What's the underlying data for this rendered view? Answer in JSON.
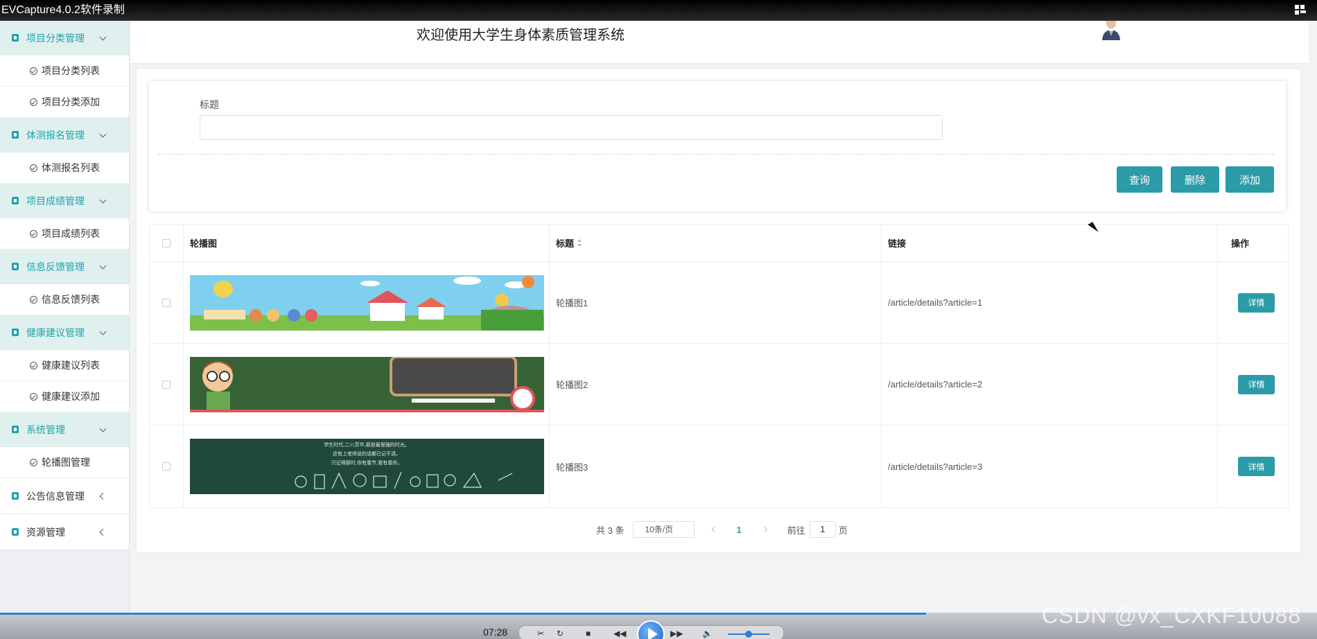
{
  "recorder": {
    "title": "EVCapture4.0.2软件录制",
    "time": "07:28",
    "watermark": "CSDN @vx_CXKF10088"
  },
  "header": {
    "title": "欢迎使用大学生身体素质管理系统"
  },
  "sidebar": {
    "groups": [
      {
        "label": "项目分类管理",
        "items": [
          "项目分类列表",
          "项目分类添加"
        ]
      },
      {
        "label": "体测报名管理",
        "items": [
          "体测报名列表"
        ]
      },
      {
        "label": "项目成绩管理",
        "items": [
          "项目成绩列表"
        ]
      },
      {
        "label": "信息反馈管理",
        "items": [
          "信息反馈列表"
        ]
      },
      {
        "label": "健康建议管理",
        "items": [
          "健康建议列表",
          "健康建议添加"
        ]
      },
      {
        "label": "系统管理",
        "items": [
          "轮播图管理"
        ]
      },
      {
        "label": "公告信息管理",
        "items": []
      },
      {
        "label": "资源管理",
        "items": []
      }
    ]
  },
  "search": {
    "label": "标题",
    "value": "",
    "buttons": {
      "query": "查询",
      "delete": "删除",
      "add": "添加"
    }
  },
  "table": {
    "headers": {
      "image": "轮播图",
      "title": "标题",
      "link": "链接",
      "op": "操作"
    },
    "rows": [
      {
        "title": "轮播图1",
        "link": "/article/details?article=1",
        "action": "详情"
      },
      {
        "title": "轮播图2",
        "link": "/article/details?article=2",
        "action": "详情"
      },
      {
        "title": "轮播图3",
        "link": "/article/details?article=3",
        "action": "详情"
      }
    ],
    "banner3_text": [
      "学生时代,二八芳华,那是最倔强的时光。",
      "还有上老师说的话都已记不清。",
      "只记得那时,你有童节,我有童你。"
    ]
  },
  "pagination": {
    "total": "共 3 条",
    "page_size": "10条/页",
    "current": "1",
    "goto_label": "前往",
    "goto_value": "1",
    "page_suffix": "页"
  },
  "colors": {
    "accent": "#2b9ba8",
    "menu_active_bg": "#dff0ee"
  }
}
